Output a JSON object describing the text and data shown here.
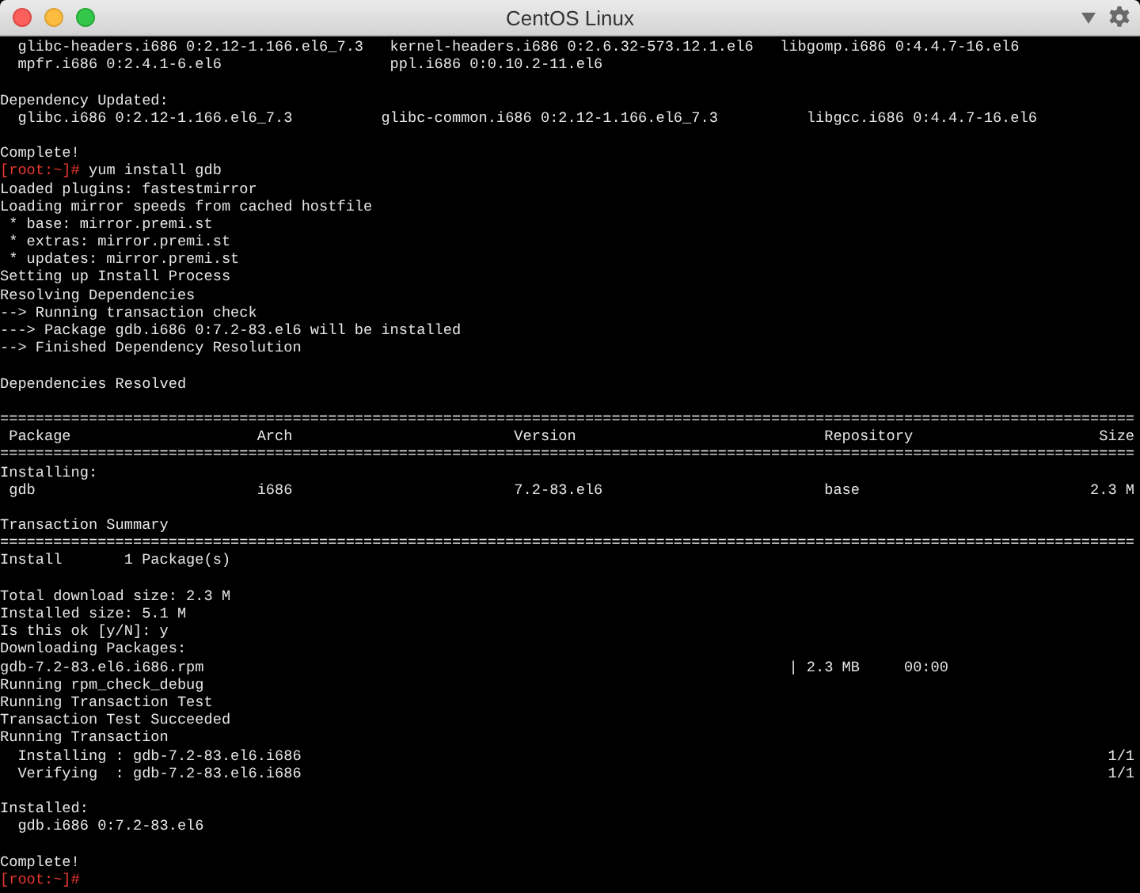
{
  "window": {
    "title": "CentOS Linux"
  },
  "terminal": {
    "lines": [
      {
        "kind": "text",
        "text": "  glibc-headers.i686 0:2.12-1.166.el6_7.3   kernel-headers.i686 0:2.6.32-573.12.1.el6   libgomp.i686 0:4.4.7-16.el6"
      },
      {
        "kind": "text",
        "text": "  mpfr.i686 0:2.4.1-6.el6                   ppl.i686 0:0.10.2-11.el6"
      },
      {
        "kind": "blank"
      },
      {
        "kind": "text",
        "text": "Dependency Updated:"
      },
      {
        "kind": "text",
        "text": "  glibc.i686 0:2.12-1.166.el6_7.3          glibc-common.i686 0:2.12-1.166.el6_7.3          libgcc.i686 0:4.4.7-16.el6"
      },
      {
        "kind": "blank"
      },
      {
        "kind": "text",
        "text": "Complete!"
      },
      {
        "kind": "prompt",
        "prompt": "[root:~]#",
        "command": "yum install gdb"
      },
      {
        "kind": "text",
        "text": "Loaded plugins: fastestmirror"
      },
      {
        "kind": "text",
        "text": "Loading mirror speeds from cached hostfile"
      },
      {
        "kind": "text",
        "text": " * base: mirror.premi.st"
      },
      {
        "kind": "text",
        "text": " * extras: mirror.premi.st"
      },
      {
        "kind": "text",
        "text": " * updates: mirror.premi.st"
      },
      {
        "kind": "text",
        "text": "Setting up Install Process"
      },
      {
        "kind": "text",
        "text": "Resolving Dependencies"
      },
      {
        "kind": "text",
        "text": "--> Running transaction check"
      },
      {
        "kind": "text",
        "text": "---> Package gdb.i686 0:7.2-83.el6 will be installed"
      },
      {
        "kind": "text",
        "text": "--> Finished Dependency Resolution"
      },
      {
        "kind": "blank"
      },
      {
        "kind": "text",
        "text": "Dependencies Resolved"
      },
      {
        "kind": "blank"
      },
      {
        "kind": "rule",
        "text": "================================================================================================================================"
      },
      {
        "kind": "text",
        "text": " Package                     Arch                         Version                            Repository                     Size"
      },
      {
        "kind": "rule",
        "text": "================================================================================================================================"
      },
      {
        "kind": "text",
        "text": "Installing:"
      },
      {
        "kind": "text",
        "text": " gdb                         i686                         7.2-83.el6                         base                          2.3 M"
      },
      {
        "kind": "blank"
      },
      {
        "kind": "text",
        "text": "Transaction Summary"
      },
      {
        "kind": "rule",
        "text": "================================================================================================================================"
      },
      {
        "kind": "text",
        "text": "Install       1 Package(s)"
      },
      {
        "kind": "blank"
      },
      {
        "kind": "text",
        "text": "Total download size: 2.3 M"
      },
      {
        "kind": "text",
        "text": "Installed size: 5.1 M"
      },
      {
        "kind": "text",
        "text": "Is this ok [y/N]: y"
      },
      {
        "kind": "text",
        "text": "Downloading Packages:"
      },
      {
        "kind": "text",
        "text": "gdb-7.2-83.el6.i686.rpm                                                                  | 2.3 MB     00:00"
      },
      {
        "kind": "text",
        "text": "Running rpm_check_debug"
      },
      {
        "kind": "text",
        "text": "Running Transaction Test"
      },
      {
        "kind": "text",
        "text": "Transaction Test Succeeded"
      },
      {
        "kind": "text",
        "text": "Running Transaction"
      },
      {
        "kind": "text",
        "text": "  Installing : gdb-7.2-83.el6.i686                                                                                           1/1"
      },
      {
        "kind": "text",
        "text": "  Verifying  : gdb-7.2-83.el6.i686                                                                                           1/1"
      },
      {
        "kind": "blank"
      },
      {
        "kind": "text",
        "text": "Installed:"
      },
      {
        "kind": "text",
        "text": "  gdb.i686 0:7.2-83.el6"
      },
      {
        "kind": "blank"
      },
      {
        "kind": "text",
        "text": "Complete!"
      },
      {
        "kind": "prompt",
        "prompt": "[root:~]#"
      }
    ]
  }
}
